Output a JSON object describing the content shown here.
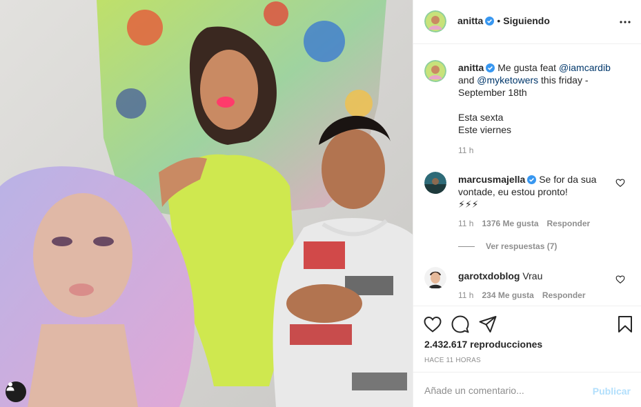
{
  "post": {
    "username": "anitta",
    "follow_status": "Siguiendo",
    "separator": "•"
  },
  "caption": {
    "username": "anitta",
    "text_before": "Me gusta feat ",
    "mention1": "@iamcardib",
    "text_mid": " and ",
    "mention2": "@myketowers",
    "text_after": " this friday - September 18th",
    "line2": "Esta sexta",
    "line3": "Este viernes",
    "time": "11 h"
  },
  "comments": [
    {
      "username": "marcusmajella",
      "text": "Se for da sua vontade, eu estou pronto!",
      "emoji": "⚡⚡⚡",
      "time": "11 h",
      "likes": "1376 Me gusta",
      "reply": "Responder",
      "view_replies": "Ver respuestas (7)"
    },
    {
      "username": "garotxdoblog",
      "text": "Vrau",
      "time": "11 h",
      "likes": "234 Me gusta",
      "reply": "Responder"
    }
  ],
  "stats": {
    "views": "2.432.617 reproducciones",
    "posted": "HACE 11 HORAS"
  },
  "composer": {
    "placeholder": "Añade un comentario...",
    "publish": "Publicar"
  },
  "colors": {
    "verified": "#3897f0",
    "mention": "#00376b",
    "muted": "#8e8e8e",
    "publish_disabled": "#b2dffc"
  }
}
